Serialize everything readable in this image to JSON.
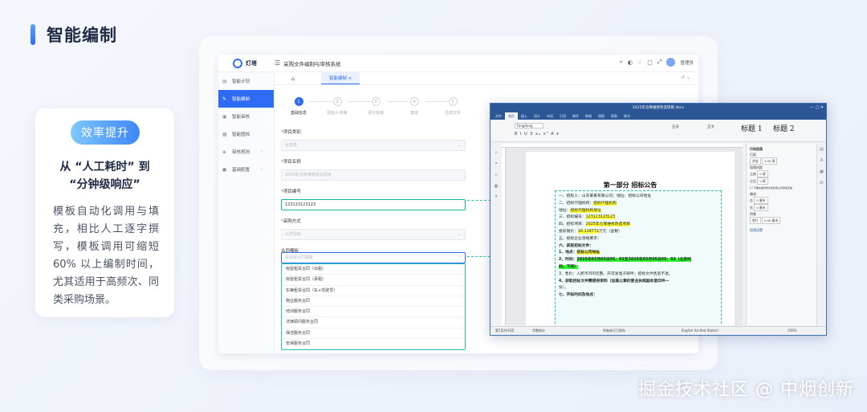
{
  "page": {
    "title": "智能编制"
  },
  "benefit": {
    "badge": "效率提升",
    "heading_line1": "从 “人工耗时” 到",
    "heading_line2": "“分钟级响应”",
    "body": "模板自动化调用与填充，相比人工逐字撰写，模板调用可缩短60% 以上编制时间，尤其适用于高频次、同类采购场景。"
  },
  "app": {
    "logo_text": "灯塔",
    "system_title": "采购文件编制与审核系统",
    "user_name": "管理员",
    "sidebar": [
      {
        "label": "智能计划",
        "icon": "calendar-icon"
      },
      {
        "label": "智能编制",
        "icon": "edit-icon",
        "active": true
      },
      {
        "label": "智能审核",
        "icon": "audit-icon"
      },
      {
        "label": "智能图档",
        "icon": "archive-icon"
      },
      {
        "label": "审核规则",
        "icon": "rule-icon",
        "expand": "›"
      },
      {
        "label": "基础配置",
        "icon": "user-icon",
        "expand": "›"
      }
    ],
    "tabs": {
      "home_icon": "⌂",
      "active_label": "智能编制 ×",
      "tools": "↺  ⌄"
    },
    "steps": [
      {
        "num": "1",
        "label": "基础信息",
        "active": true
      },
      {
        "num": "2",
        "label": "招标人资格"
      },
      {
        "num": "3",
        "label": "评分标准"
      },
      {
        "num": "4",
        "label": "其他"
      },
      {
        "num": "5",
        "label": "生成文件"
      }
    ],
    "form": {
      "project_category_label": "项目类别",
      "project_category_placeholder": "业务类",
      "project_name_label": "项目名称",
      "project_name_placeholder": "2025年仓库维修改造项目",
      "project_code_label": "项目编号",
      "project_code_value": "123123123123",
      "purchase_method_label": "采购方式",
      "purchase_method_placeholder": "公开招标",
      "contract_template_label": "合同模板",
      "contract_template_placeholder": "请选择合同模板",
      "contract_options": [
        "房屋租赁合同（出租）",
        "房屋租赁合同（承租）",
        "车辆租赁合同（车+驾驶员）",
        "物业服务合同",
        "培训服务合同",
        "法律顾问服务合同",
        "保洁服务合同",
        "安保服务合同"
      ]
    }
  },
  "doc": {
    "window_title": "2025年仓库维修改造项目 docx",
    "ribbon_tabs": [
      "文件",
      "首页",
      "插入",
      "设计",
      "布局",
      "引用",
      "邮件",
      "审阅",
      "视图",
      "帮助",
      "格式"
    ],
    "font_name": "FangSong",
    "style1": "标题 1",
    "style2": "标题 2",
    "font_size_mini": "五号",
    "style_normal": "正文",
    "doc_heading": "第一部分   招标公告",
    "lines": [
      {
        "text": "一、招标人：山东某某有限公司；地址：招标公司地址",
        "hl": ""
      },
      {
        "text": "二、招标代理机构：",
        "extra": "招标代理机构",
        "hl": "y-extra"
      },
      {
        "text": "    地址：",
        "extra": "招标代理机构地址",
        "hl": "y-extra"
      },
      {
        "text": "三、招标编号：",
        "extra": "123123123123",
        "hl": "y-extra"
      },
      {
        "text": "四、招标项目：",
        "extra": "2025年仓库维修改造项目",
        "hl": "y-extra"
      },
      {
        "text": "    投标限价：",
        "extra": "16.118772",
        "tail": "万元（含税）",
        "hl": "y-extra"
      },
      {
        "text": "五、投标企业资格要求：",
        "hl": ""
      },
      {
        "text": " ",
        "hl": ""
      },
      {
        "text": "六、获取招标文件：",
        "hl": "",
        "bold": true
      },
      {
        "text": "1、地点：",
        "extra": "招标公司地址",
        "hl": "y-extra",
        "bold": true
      },
      {
        "text": "2、时间：",
        "extra": "2025年03月03日05：02至2025年03月05日05：02（北京时",
        "hl": "g-extra",
        "bold": true
      },
      {
        "text": "间，下同）",
        "hl": "g",
        "bold": true
      },
      {
        "text": "3、售价：人民币300元整，开可发电子邮件；招标文件售后不退。",
        "hl": ""
      },
      {
        "text": "4、获取招标文件需提供资料（加盖公章的营业执照副本复印件一",
        "hl": "",
        "bold": true
      },
      {
        "text": "份）。",
        "hl": ""
      },
      {
        "text": "七、开标时间及地点：",
        "hl": "",
        "bold": true
      },
      {
        "text": "        ",
        "extra": "                    ",
        "hl": "g-extra"
      }
    ],
    "pane": {
      "title": "行和段落",
      "spacing_label": "行距",
      "spacing_value": "多倍",
      "spacing_num": "3.00 磅",
      "para_label": "段落间距",
      "before_label": "之前",
      "before_value": "0 磅",
      "after_label": "之后",
      "after_value": "0 磅",
      "check_label": "不要在相同样式的段落之间添加空格",
      "indent_label": "缩进",
      "left_label": "左",
      "left_value": "0 厘米",
      "right_label": "右",
      "right_value": "0 厘米",
      "special_label": "特殊",
      "special_value": "首行",
      "special_num": "0.85 厘米",
      "preview_label": "段落设置"
    },
    "status": {
      "page": "第1页共43页",
      "words": "字数统计",
      "track": "所有修订已保存",
      "lang": "English (United States)",
      "zoom": "100%"
    }
  },
  "watermark": "掘金技术社区 @ 中烟创新"
}
